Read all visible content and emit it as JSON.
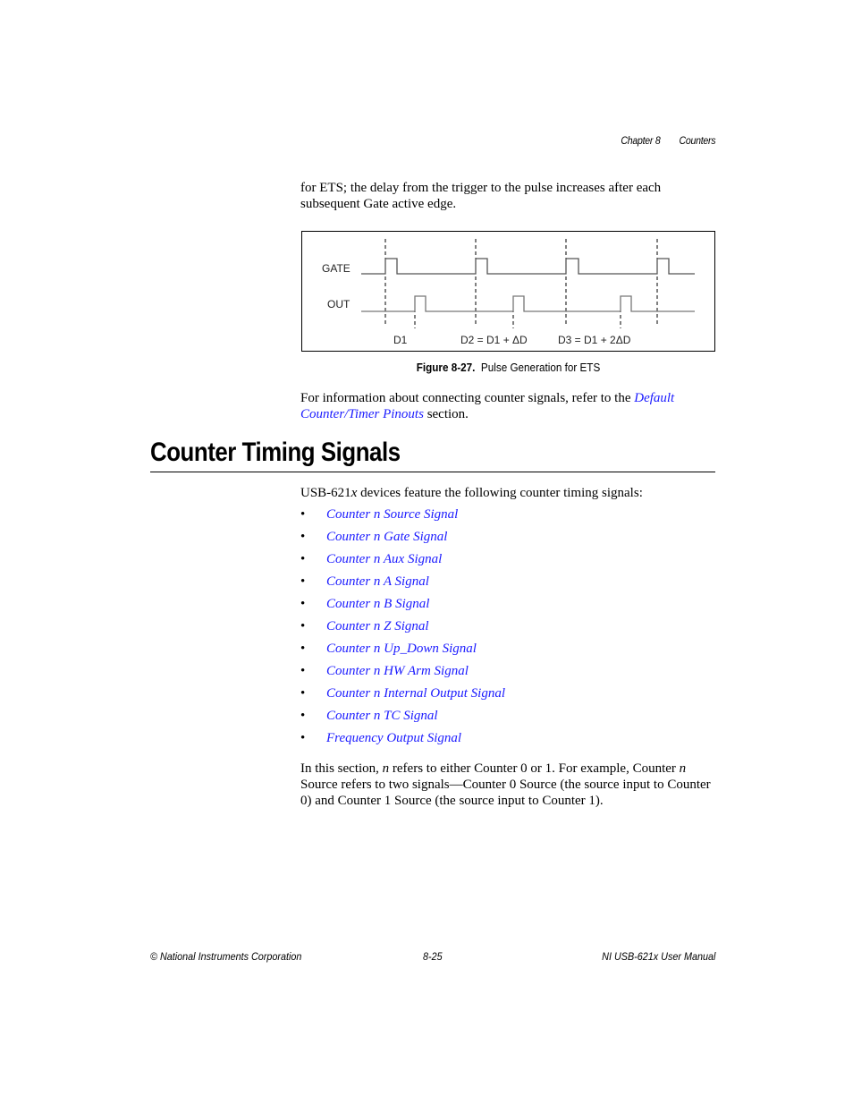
{
  "header": {
    "chapter": "Chapter 8",
    "section": "Counters"
  },
  "intro_paragraph": "for ETS; the delay from the trigger to the pulse increases after each subsequent Gate active edge.",
  "figure": {
    "signal_labels": {
      "gate": "GATE",
      "out": "OUT"
    },
    "delay_labels": [
      "D1",
      "D2 = D1 + ΔD",
      "D3 = D1 + 2ΔD"
    ],
    "caption_number": "Figure 8-27.",
    "caption_title": "Pulse Generation for ETS"
  },
  "connect_paragraph": {
    "before": "For information about connecting counter signals, refer to the ",
    "link": "Default Counter/Timer Pinouts",
    "after": " section."
  },
  "section": {
    "title": "Counter Timing Signals",
    "intro_prefix": "USB-621",
    "intro_var": "x",
    "intro_suffix": " devices feature the following counter timing signals:",
    "bullet": "•",
    "items": [
      "Counter n Source Signal",
      "Counter n Gate Signal",
      "Counter n Aux Signal",
      "Counter n A Signal",
      "Counter n B Signal",
      "Counter n Z Signal",
      "Counter n Up_Down Signal",
      "Counter n HW Arm Signal",
      "Counter n Internal Output Signal",
      "Counter n TC Signal",
      "Frequency Output Signal"
    ],
    "note": {
      "t1": "In this section, ",
      "n": "n",
      "t2": " refers to either Counter 0 or 1. For example, Counter ",
      "t3": " Source refers to two signals—Counter 0 Source (the source input to Counter 0) and Counter 1 Source (the source input to Counter 1)."
    }
  },
  "footer": {
    "left": "© National Instruments Corporation",
    "center": "8-25",
    "right": "NI USB-621x User Manual"
  },
  "colors": {
    "link": "#1a1aff",
    "text": "#000000"
  }
}
